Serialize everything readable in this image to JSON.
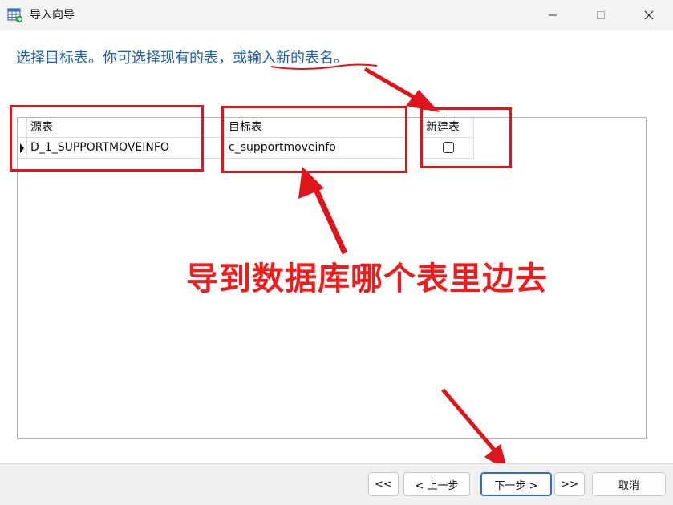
{
  "window": {
    "title": "导入向导",
    "icon": "table-import-icon",
    "controls": [
      "minimize-icon",
      "maximize-icon",
      "close-icon"
    ]
  },
  "instruction": {
    "text": "选择目标表。你可选择现有的表，或输入新的表名。"
  },
  "grid": {
    "columns": [
      "源表",
      "目标表",
      "新建表"
    ],
    "rows": [
      {
        "source": "D_1_SUPPORTMOVEINFO",
        "target": "c_supportmoveinfo",
        "new_table": false
      }
    ]
  },
  "annotation": {
    "text": "导到数据库哪个表里边去",
    "color": "#ee1c1c"
  },
  "footer": {
    "first_label": "<<",
    "prev_label": "< 上一步",
    "next_label": "下一步 >",
    "last_label": ">>",
    "cancel_label": "取消"
  },
  "colors": {
    "instruction": "#1f5fb0",
    "highlight": "#e0151b",
    "primary_border": "#2f6fc9"
  }
}
